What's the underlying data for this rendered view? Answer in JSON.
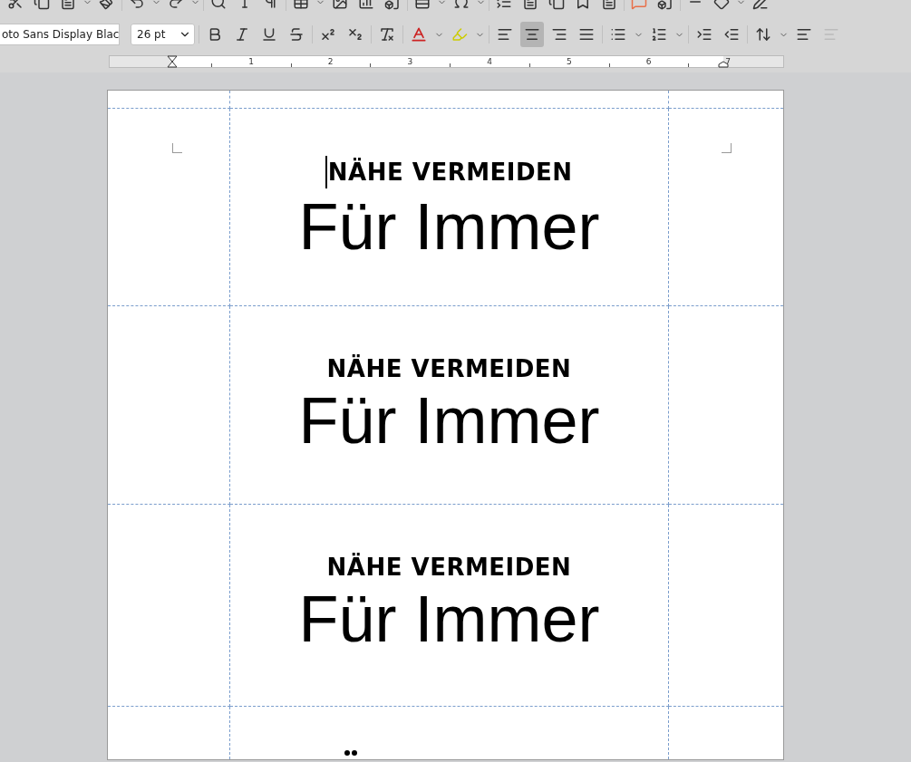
{
  "toolbar": {
    "font_name": "oto Sans Display Blac",
    "font_size": "26 pt",
    "alignment": [
      {
        "kind": "left",
        "selected": false
      },
      {
        "kind": "center",
        "selected": true
      },
      {
        "kind": "right",
        "selected": false
      },
      {
        "kind": "justify",
        "selected": false
      }
    ]
  },
  "ruler": {
    "marks": [
      "1",
      "2",
      "3",
      "4",
      "5",
      "6",
      "7"
    ]
  },
  "labels": [
    {
      "heading": "NÄHE VERMEIDEN",
      "text": "Für Immer",
      "cursor": true
    },
    {
      "heading": "NÄHE VERMEIDEN",
      "text": "Für Immer",
      "cursor": false
    },
    {
      "heading": "NÄHE VERMEIDEN",
      "text": "Für Immer",
      "cursor": false
    }
  ]
}
